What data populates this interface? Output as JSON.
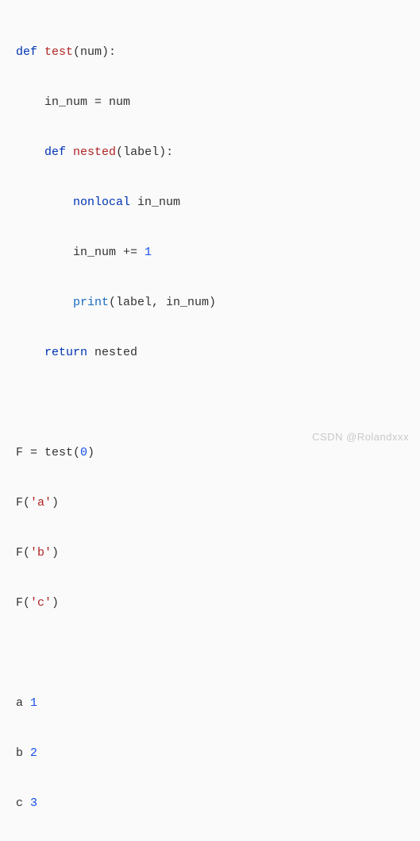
{
  "code": {
    "l1_kw": "def",
    "l1_fn": "test",
    "l1_rest": "(num):",
    "l2": "    in_num = num",
    "l3_indent": "    ",
    "l3_kw": "def",
    "l3_fn": "nested",
    "l3_rest": "(label):",
    "l4_indent": "        ",
    "l4_kw": "nonlocal",
    "l4_rest": " in_num",
    "l5_a": "        in_num += ",
    "l5_num": "1",
    "l6_indent": "        ",
    "l6_call": "print",
    "l6_rest": "(label, in_num)",
    "l7_indent": "    ",
    "l7_kw": "return",
    "l7_rest": " nested",
    "l9_a": "F = test(",
    "l9_num": "0",
    "l9_b": ")",
    "l10_a": "F(",
    "l10_str": "'a'",
    "l10_b": ")",
    "l11_a": "F(",
    "l11_str": "'b'",
    "l11_b": ")",
    "l12_a": "F(",
    "l12_str": "'c'",
    "l12_b": ")"
  },
  "output": {
    "o1_a": "a ",
    "o1_n": "1",
    "o2_a": "b ",
    "o2_n": "2",
    "o3_a": "c ",
    "o3_n": "3"
  },
  "watermark": "CSDN @Rolandxxx"
}
